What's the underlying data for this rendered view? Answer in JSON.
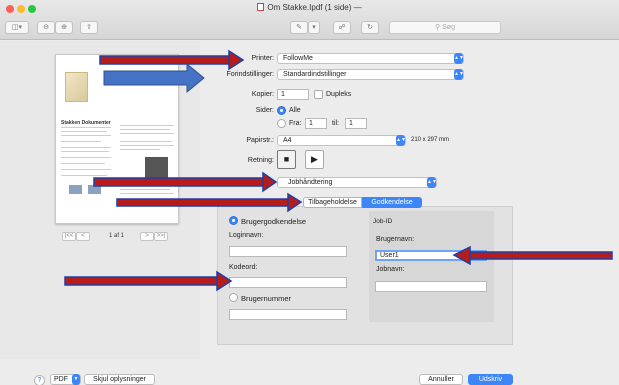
{
  "window": {
    "title": "Om Stakke.Ipdf (1 side)",
    "title_suffix": "—"
  },
  "toolbar": {
    "search_placeholder": "Søg"
  },
  "preview": {
    "heading": "Stakken Dokumenter"
  },
  "pager": {
    "first": "|<<",
    "prev": "<",
    "label": "1 af 1",
    "next": ">",
    "last": ">>|"
  },
  "print": {
    "printer_label": "Printer:",
    "printer_value": "FollowMe",
    "presets_label": "Forindstillinger:",
    "presets_value": "Standardindstillinger",
    "copies_label": "Kopier:",
    "copies_value": "1",
    "duplex_label": "Dupleks",
    "pages_label": "Sider:",
    "pages_all": "Alle",
    "pages_from": "Fra:",
    "from_value": "1",
    "to_label": "til:",
    "to_value": "1",
    "paper_label": "Papirstr.:",
    "paper_value": "A4",
    "paper_dims": "210 x 297 mm",
    "orientation_label": "Retning:",
    "section_value": "Jobhåndtering",
    "tab_retention": "Tilbageholdelse",
    "tab_approval": "Godkendelse"
  },
  "approval": {
    "user_approval": "Brugergodkendelse",
    "login_label": "Loginnavn:",
    "password_label": "Kodeord:",
    "user_number": "Brugernummer",
    "job_id": "Job-ID",
    "username_label": "Brugernavn:",
    "username_value": "User1",
    "jobname_label": "Jobnavn:"
  },
  "bottom": {
    "help": "?",
    "pdf": "PDF",
    "hide_details": "Skjul oplysninger",
    "cancel": "Annuller",
    "print": "Udskriv"
  },
  "colors": {
    "accent": "#3c86f7",
    "arrow_fill": "#b71c1c",
    "arrow_outline": "#1f3fa5",
    "block_arrow": "#4472c4"
  },
  "icons": [
    "sidebar-icon",
    "zoom-out-icon",
    "zoom-in-icon",
    "share-icon",
    "pen-icon",
    "markup-icon",
    "rotate-icon",
    "search-icon"
  ]
}
